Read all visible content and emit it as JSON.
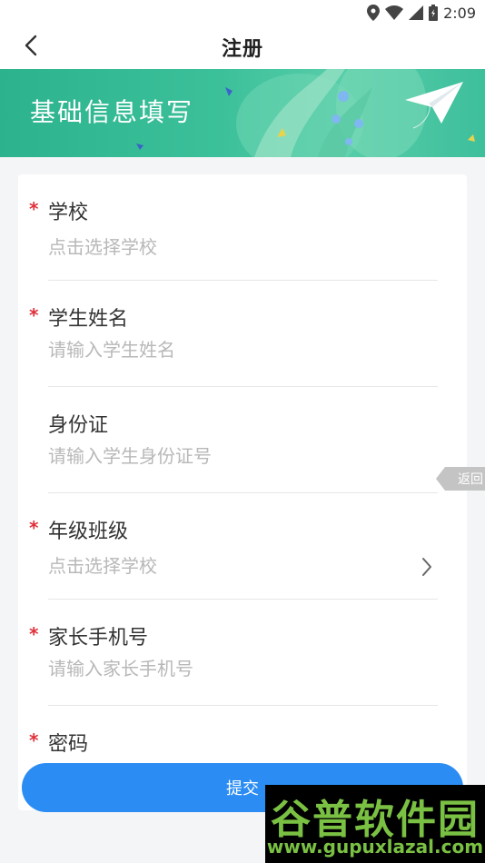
{
  "status_bar": {
    "time": "2:09",
    "icons": [
      "location-icon",
      "wifi-icon",
      "signal-icon",
      "battery-icon"
    ]
  },
  "nav": {
    "title": "注册",
    "back_icon": "chevron-left-icon"
  },
  "banner": {
    "title": "基础信息填写",
    "decor_icon": "paper-plane-icon"
  },
  "form": {
    "fields": [
      {
        "label": "学校",
        "required": true,
        "placeholder": "点击选择学校",
        "type": "select"
      },
      {
        "label": "学生姓名",
        "required": true,
        "placeholder": "请输入学生姓名",
        "type": "input"
      },
      {
        "label": "身份证",
        "required": false,
        "placeholder": "请输入学生身份证号",
        "type": "input"
      },
      {
        "label": "年级班级",
        "required": true,
        "placeholder": "点击选择学校",
        "type": "select",
        "chevron_icon": "chevron-right-icon"
      },
      {
        "label": "家长手机号",
        "required": true,
        "placeholder": "请输入家长手机号",
        "type": "input"
      },
      {
        "label": "密码",
        "required": true,
        "placeholder": "",
        "type": "input"
      }
    ],
    "required_mark": "*"
  },
  "submit": {
    "label": "提交"
  },
  "return_tab": {
    "label": "返回"
  },
  "watermark": {
    "line1": "谷普软件园",
    "line2": "www.gupuxlazal.com"
  },
  "colors": {
    "accent": "#2b8cf3",
    "banner": "#2cb38d",
    "required": "#e0303a",
    "placeholder": "#b8b8b8"
  }
}
